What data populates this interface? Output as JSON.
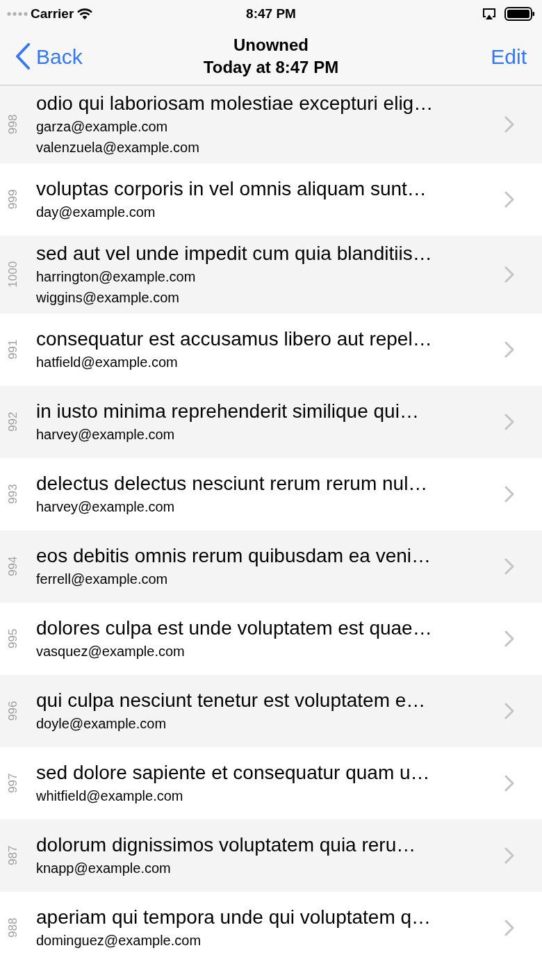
{
  "status_bar": {
    "carrier": "Carrier",
    "time": "8:47 PM"
  },
  "nav": {
    "back": "Back",
    "title": "Unowned",
    "subtitle": "Today at 8:47 PM",
    "edit": "Edit"
  },
  "rows": [
    {
      "number": "998",
      "title": "odio qui laboriosam molestiae excepturi elig…",
      "emails": [
        "garza@example.com",
        "valenzuela@example.com"
      ]
    },
    {
      "number": "999",
      "title": "voluptas corporis in vel omnis aliquam sunt…",
      "emails": [
        "day@example.com"
      ]
    },
    {
      "number": "1000",
      "title": "sed aut vel unde impedit cum quia blanditiis…",
      "emails": [
        "harrington@example.com",
        "wiggins@example.com"
      ]
    },
    {
      "number": "991",
      "title": "consequatur est accusamus libero aut repel…",
      "emails": [
        "hatfield@example.com"
      ]
    },
    {
      "number": "992",
      "title": "in iusto minima reprehenderit similique qui…",
      "emails": [
        "harvey@example.com"
      ]
    },
    {
      "number": "993",
      "title": "delectus delectus nesciunt rerum rerum nul…",
      "emails": [
        "harvey@example.com"
      ]
    },
    {
      "number": "994",
      "title": "eos debitis omnis rerum quibusdam ea veni…",
      "emails": [
        "ferrell@example.com"
      ]
    },
    {
      "number": "995",
      "title": "dolores culpa est unde voluptatem est quae…",
      "emails": [
        "vasquez@example.com"
      ]
    },
    {
      "number": "996",
      "title": "qui culpa nesciunt tenetur est voluptatem e…",
      "emails": [
        "doyle@example.com"
      ]
    },
    {
      "number": "997",
      "title": "sed dolore sapiente et consequatur quam u…",
      "emails": [
        "whitfield@example.com"
      ]
    },
    {
      "number": "987",
      "title": "dolorum dignissimos voluptatem quia reru…",
      "emails": [
        "knapp@example.com"
      ]
    },
    {
      "number": "988",
      "title": "aperiam qui tempora unde qui voluptatem q…",
      "emails": [
        "dominguez@example.com"
      ]
    }
  ]
}
